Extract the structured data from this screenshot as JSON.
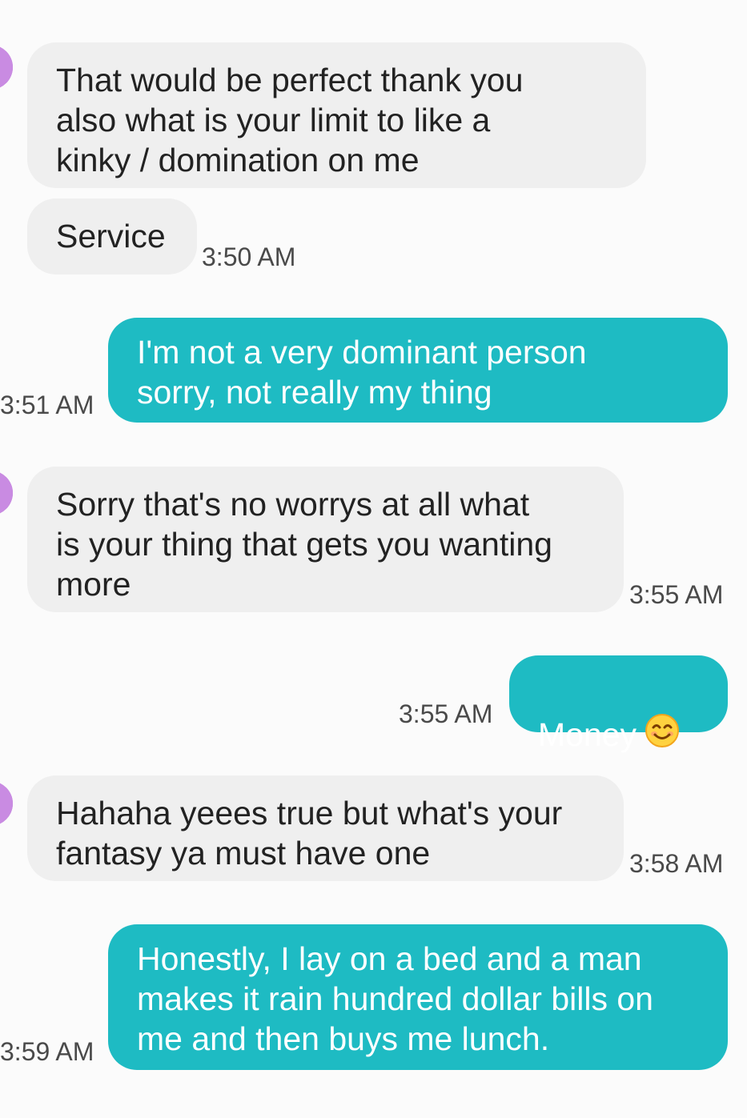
{
  "colors": {
    "incoming_bubble": "#efefef",
    "outgoing_bubble": "#1ebbc3",
    "avatar": "#b86fd6",
    "background": "#fbfbfb"
  },
  "messages": [
    {
      "direction": "incoming",
      "text": "That would be perfect thank you\nalso what is your limit to like a\nkinky / domination on me",
      "time": ""
    },
    {
      "direction": "incoming",
      "text": "Service",
      "time": "3:50 AM"
    },
    {
      "direction": "outgoing",
      "text": "I'm not a very dominant person\nsorry, not really my thing",
      "time": "3:51 AM"
    },
    {
      "direction": "incoming",
      "text": "Sorry that's no worrys at all what\nis your thing that gets you wanting\nmore",
      "time": "3:55 AM"
    },
    {
      "direction": "outgoing",
      "text": "Money",
      "emoji": "smiling-face-with-smiling-eyes",
      "time": "3:55 AM"
    },
    {
      "direction": "incoming",
      "text": "Hahaha yeees true but what's your\nfantasy ya must have one",
      "time": "3:58 AM"
    },
    {
      "direction": "outgoing",
      "text": "Honestly, I lay on a bed and a man\nmakes it rain hundred dollar bills on\nme and then buys me lunch.",
      "time": "3:59 AM"
    }
  ]
}
